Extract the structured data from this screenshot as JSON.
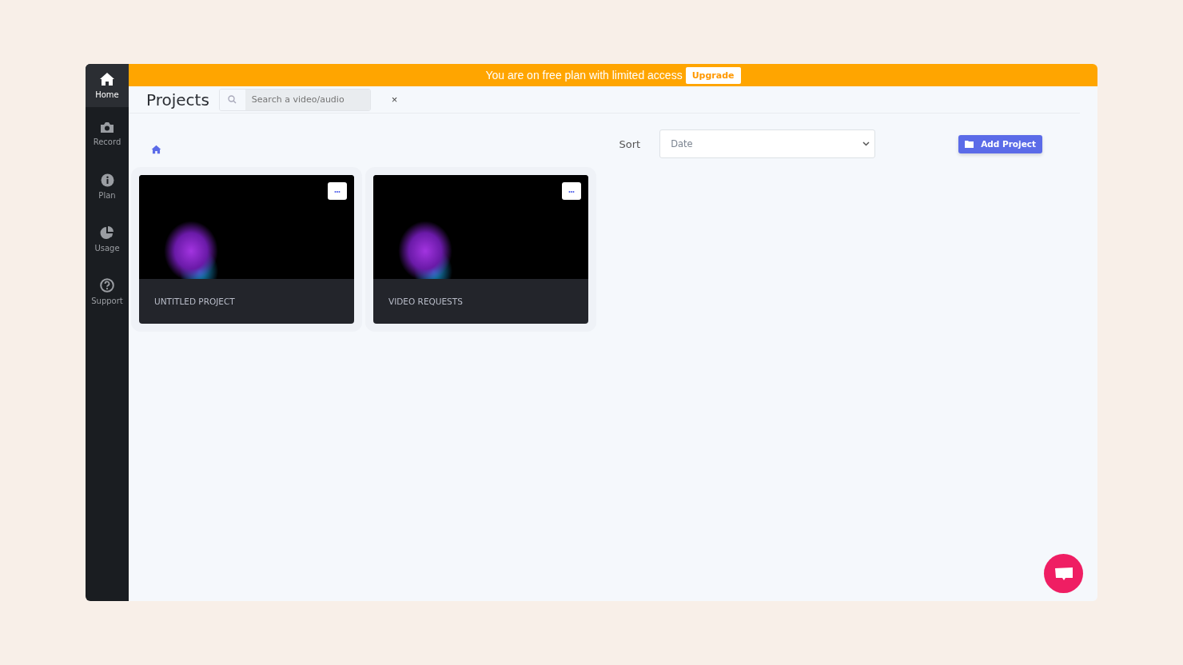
{
  "sidebar": {
    "items": [
      {
        "label": "Home",
        "kind": "home",
        "selected": true
      },
      {
        "label": "Record",
        "kind": "record",
        "selected": false
      },
      {
        "label": "Plan",
        "kind": "plan",
        "selected": false
      },
      {
        "label": "Usage",
        "kind": "usage",
        "selected": false
      },
      {
        "label": "Support",
        "kind": "support",
        "selected": false
      }
    ]
  },
  "banner": {
    "message": "You are on free plan with limited access",
    "button": "Upgrade"
  },
  "header": {
    "title": "Projects",
    "search": {
      "placeholder": "Search a video/audio"
    },
    "clear": "×"
  },
  "toolbar": {
    "sort_label": "Sort",
    "sort_value": "Date",
    "add_button": "Add Project"
  },
  "projects": [
    {
      "title": "UNTITLED PROJECT",
      "menu": "•••"
    },
    {
      "title": "VIDEO REQUESTS",
      "menu": "•••"
    }
  ]
}
